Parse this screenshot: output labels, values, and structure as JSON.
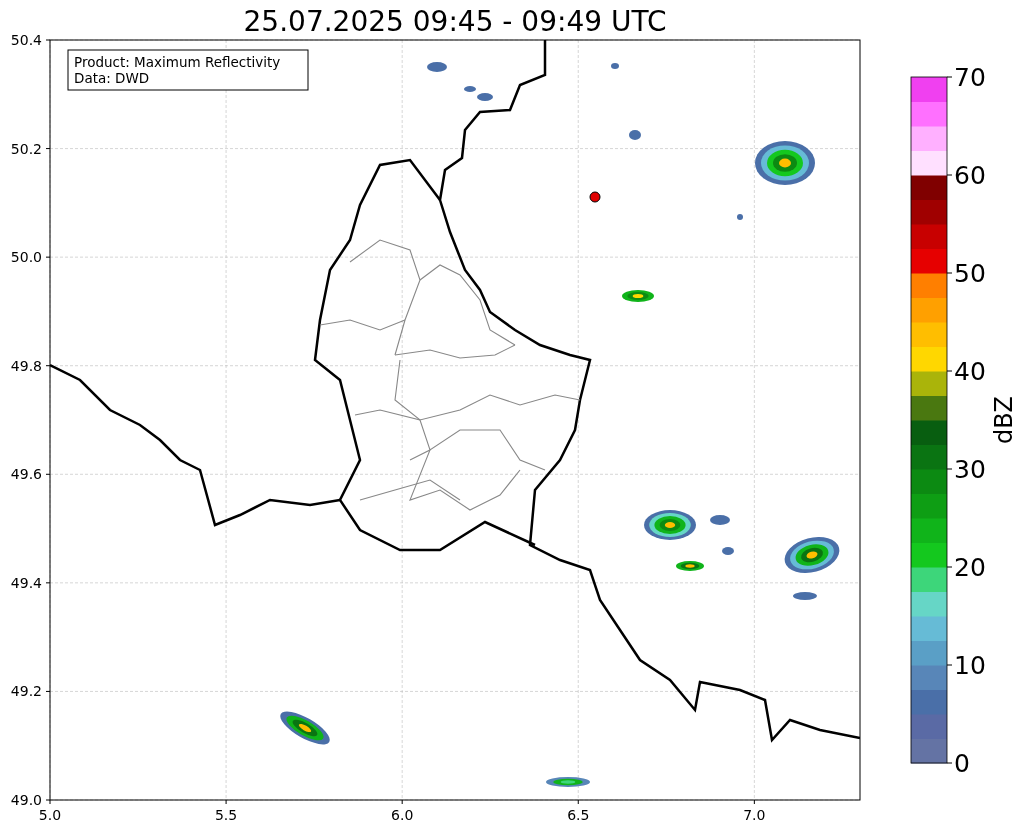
{
  "title": "25.07.2025 09:45 - 09:49 UTC",
  "info_box": [
    "Product: Maximum Reflectivity",
    "Data: DWD"
  ],
  "x_ticks": [
    "5.0",
    "5.5",
    "6.0",
    "6.5",
    "7.0"
  ],
  "y_ticks": [
    "50.4",
    "50.2",
    "50.0",
    "49.8",
    "49.6",
    "49.4",
    "49.2",
    "49.0"
  ],
  "colorbar": {
    "label": "dBZ",
    "ticks": [
      "70",
      "60",
      "50",
      "40",
      "30",
      "20",
      "10",
      "0"
    ],
    "segments": [
      {
        "color": "#6473a4"
      },
      {
        "color": "#5a6aa5"
      },
      {
        "color": "#4a6fa8"
      },
      {
        "color": "#5886b8"
      },
      {
        "color": "#5a9fc6"
      },
      {
        "color": "#66bbd6"
      },
      {
        "color": "#66d6c6"
      },
      {
        "color": "#3dd67a"
      },
      {
        "color": "#14c81e"
      },
      {
        "color": "#10b41a"
      },
      {
        "color": "#0e9e14"
      },
      {
        "color": "#0c8a12"
      },
      {
        "color": "#0a7412"
      },
      {
        "color": "#085e10"
      },
      {
        "color": "#4a7810"
      },
      {
        "color": "#aab40a"
      },
      {
        "color": "#ffd700"
      },
      {
        "color": "#ffbe00"
      },
      {
        "color": "#ffa000"
      },
      {
        "color": "#ff7f00"
      },
      {
        "color": "#e60000"
      },
      {
        "color": "#c80000"
      },
      {
        "color": "#a00000"
      },
      {
        "color": "#800000"
      },
      {
        "color": "#ffe0ff"
      },
      {
        "color": "#ffb0ff"
      },
      {
        "color": "#ff70ff"
      },
      {
        "color": "#f040f0"
      }
    ]
  }
}
